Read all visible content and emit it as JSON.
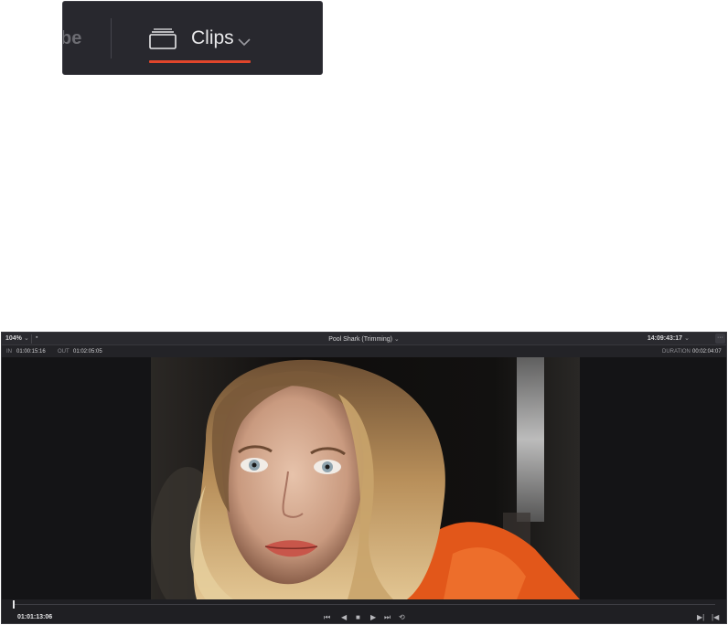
{
  "top_bar": {
    "prev_tab_partial": "be",
    "clips_label": "Clips",
    "accent_color": "#e0452b",
    "icons": [
      "clips-icon",
      "chevron-down-icon"
    ]
  },
  "viewer": {
    "zoom": "104%",
    "clip_title": "Pool Shark (Trimming)",
    "source_timecode": "14:09:43:17",
    "in_label": "IN",
    "in_value": "01:00:15:16",
    "out_label": "OUT",
    "out_value": "01:02:05:05",
    "duration_label": "DURATION",
    "duration_value": "00:02:04:07",
    "current_timecode": "01:01:13:06",
    "playhead_position": 0.0,
    "transport_icons": [
      "skip-back-icon",
      "step-back-icon",
      "stop-icon",
      "play-icon",
      "skip-forward-icon",
      "loop-icon"
    ],
    "right_icons": [
      "go-to-out-icon",
      "go-to-in-icon"
    ]
  }
}
